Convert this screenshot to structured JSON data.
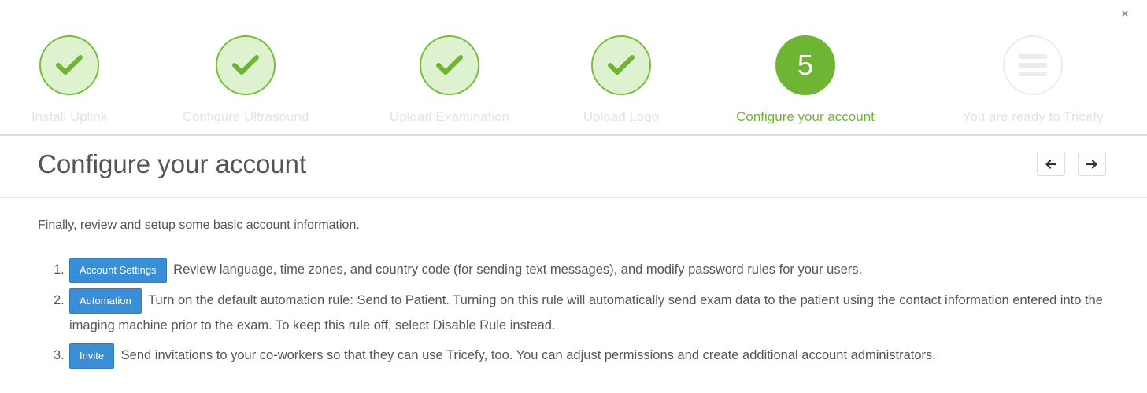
{
  "close": {
    "symbol": "×"
  },
  "wizard": {
    "steps": [
      {
        "label": "Install Uplink",
        "status": "done"
      },
      {
        "label": "Configure Ultrasound",
        "status": "done"
      },
      {
        "label": "Upload Examination",
        "status": "done"
      },
      {
        "label": "Upload Logo",
        "status": "done"
      },
      {
        "label": "Configure your account",
        "status": "active",
        "number": "5"
      },
      {
        "label": "You are ready to Tricefy",
        "status": "todo"
      }
    ]
  },
  "page": {
    "title": "Configure your account",
    "intro": "Finally, review and setup some basic account information."
  },
  "instructions": [
    {
      "num": "1.",
      "button": "Account Settings",
      "text": "Review language, time zones, and country code (for sending text messages), and modify password rules for your users."
    },
    {
      "num": "2.",
      "button": "Automation",
      "text": "Turn on the default automation rule: Send to Patient. Turning on this rule will automatically send exam data to the patient using the contact information entered into the imaging machine prior to the exam. To keep this rule off, select Disable Rule instead."
    },
    {
      "num": "3.",
      "button": "Invite",
      "text": "Send invitations to your co-workers so that they can use Tricefy, too. You can adjust permissions and create additional account administrators."
    }
  ],
  "colors": {
    "accent_green": "#6eb534",
    "done_fill": "#dff2cf",
    "button_blue": "#3a8ed6"
  },
  "icons": {
    "done": "check-icon",
    "todo": "menu-lines-icon",
    "prev": "arrow-left-icon",
    "next": "arrow-right-icon",
    "close": "close-icon"
  }
}
